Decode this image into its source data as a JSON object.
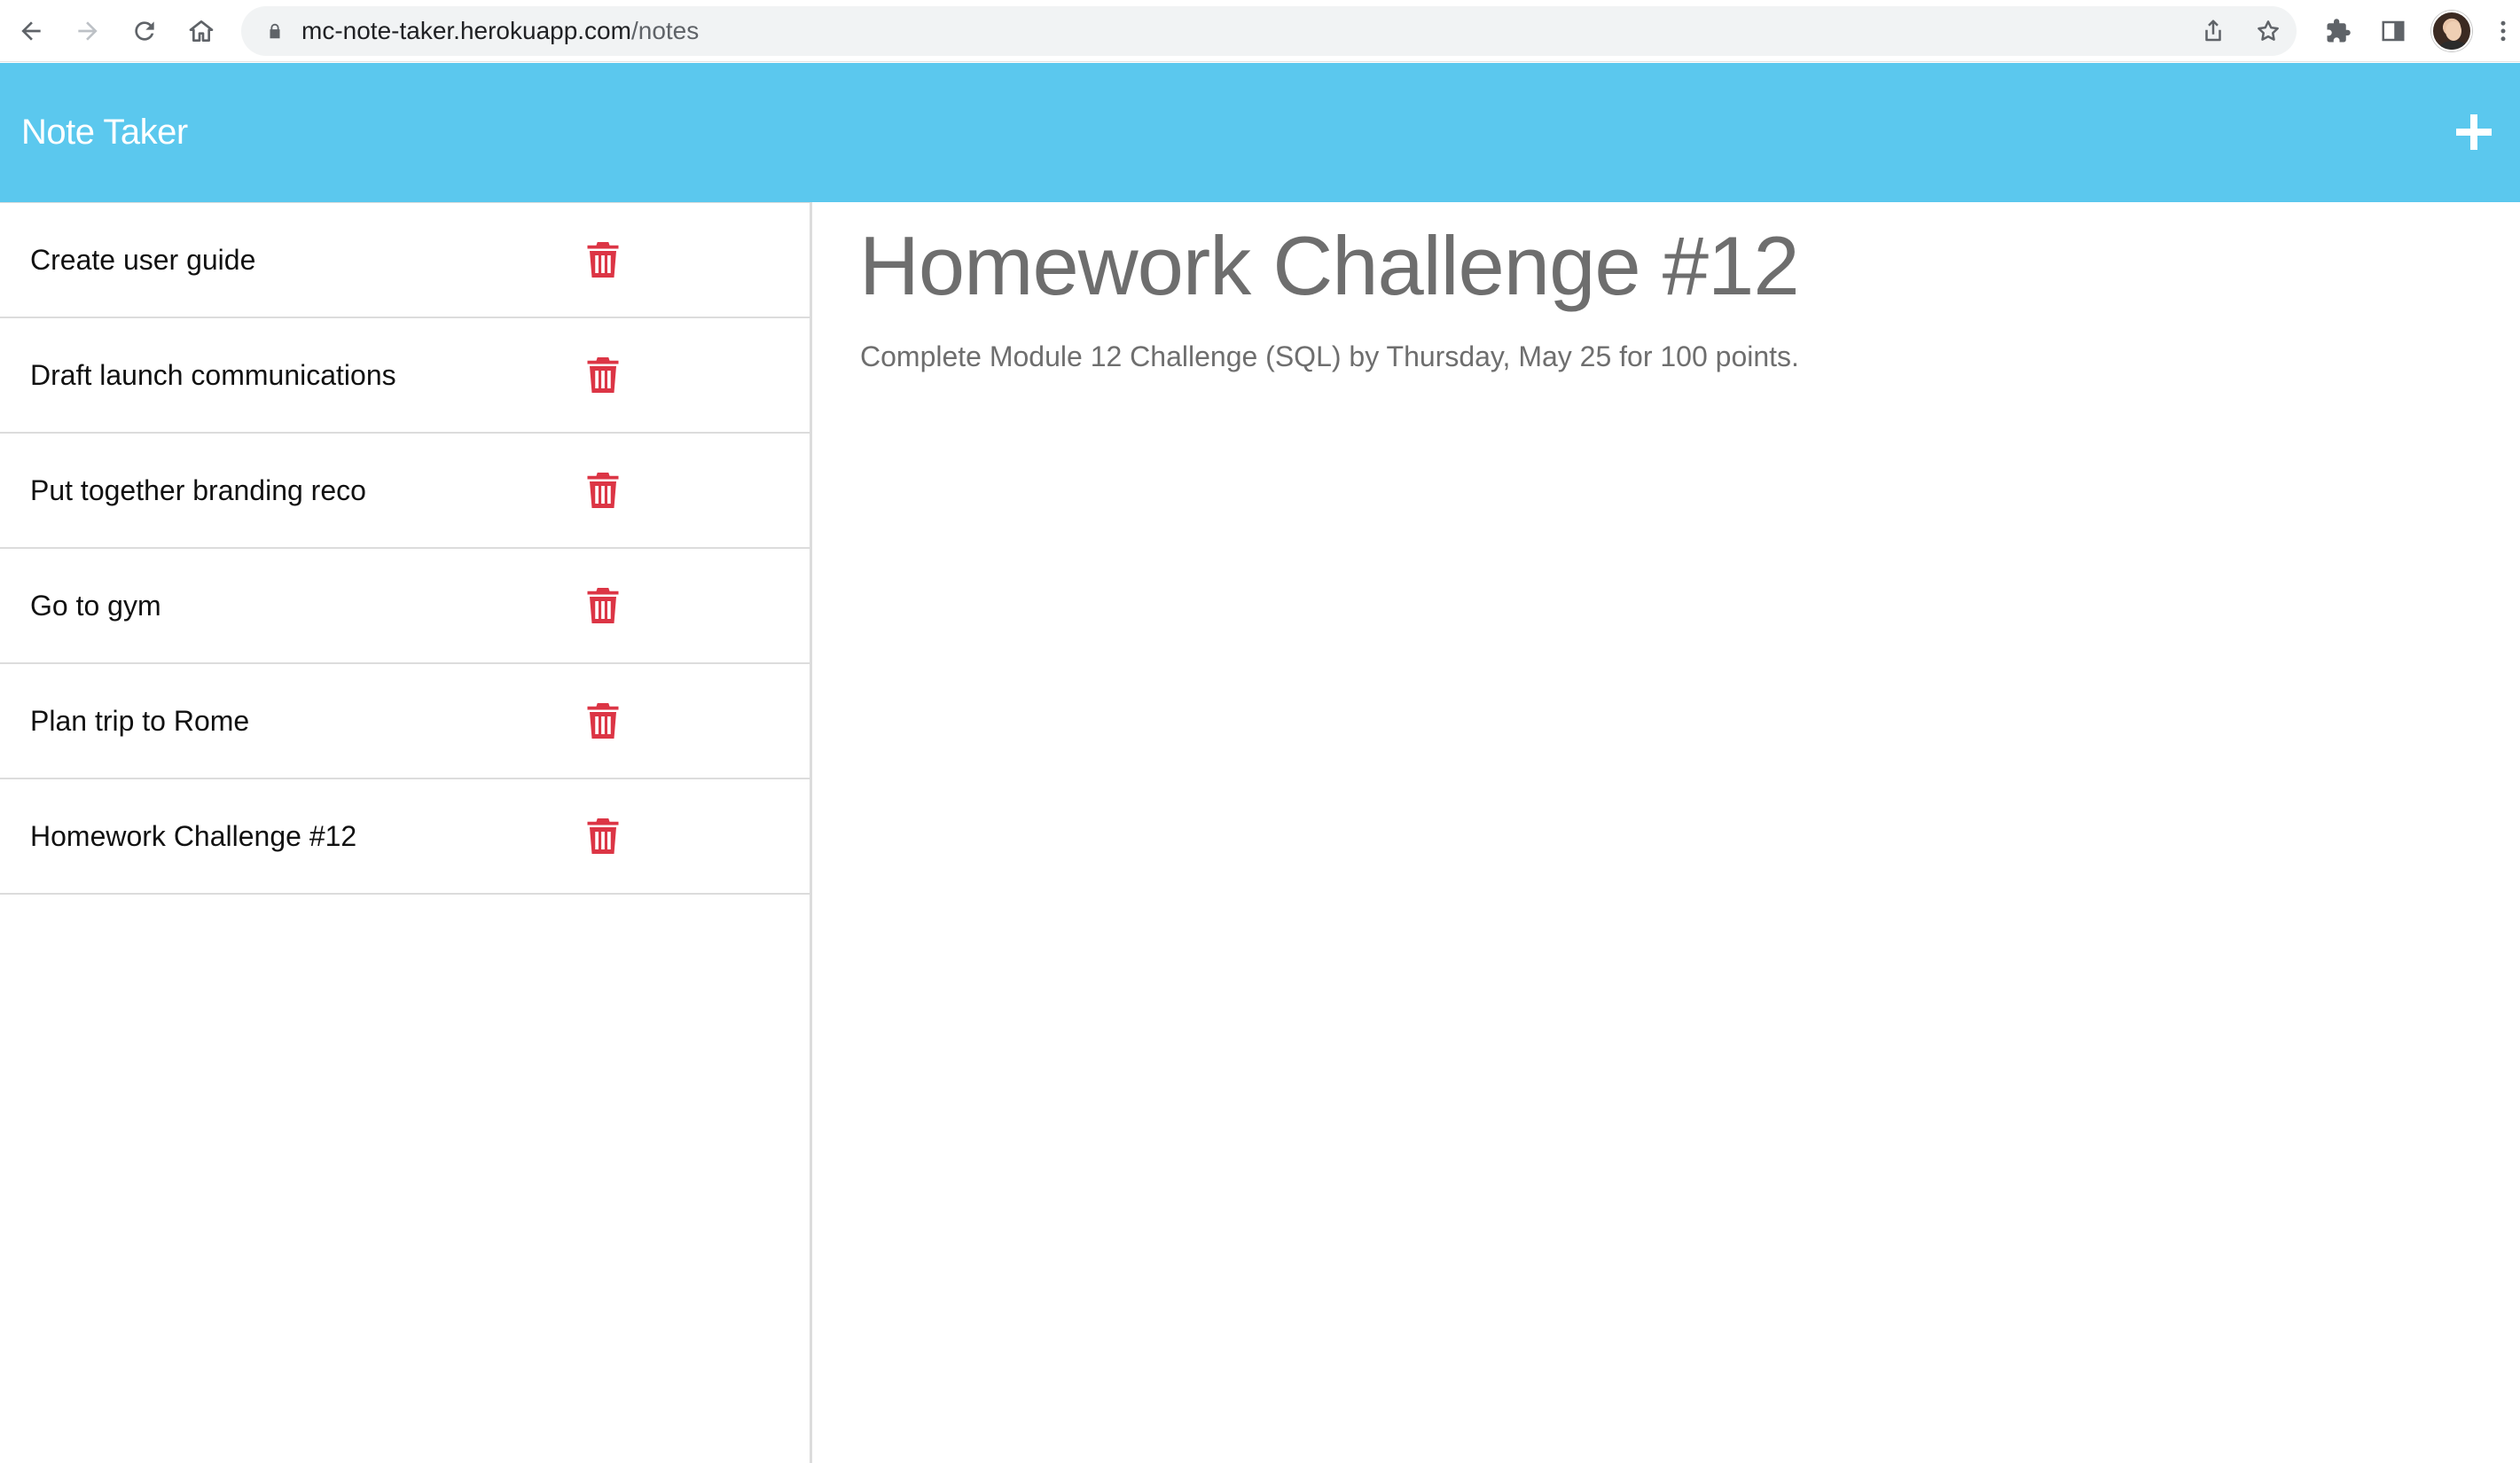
{
  "browser": {
    "url_host": "mc-note-taker.herokuapp.com",
    "url_path": "/notes",
    "icons": {
      "back": "back-arrow-icon",
      "forward": "forward-arrow-icon",
      "reload": "reload-icon",
      "home": "home-icon",
      "lock": "lock-icon",
      "share": "share-icon",
      "bookmark": "star-icon",
      "extensions": "puzzle-piece-icon",
      "side_panel": "side-panel-icon",
      "menu": "kebab-menu-icon"
    }
  },
  "app": {
    "title": "Note Taker",
    "header_color": "#5bc8ee",
    "new_note_icon": "plus-icon"
  },
  "notes": [
    {
      "title": "Create user guide",
      "delete_icon": "trash-icon"
    },
    {
      "title": "Draft launch communications",
      "delete_icon": "trash-icon"
    },
    {
      "title": "Put together branding reco",
      "delete_icon": "trash-icon"
    },
    {
      "title": "Go to gym",
      "delete_icon": "trash-icon"
    },
    {
      "title": "Plan trip to Rome",
      "delete_icon": "trash-icon"
    },
    {
      "title": "Homework Challenge #12",
      "delete_icon": "trash-icon"
    }
  ],
  "active_note": {
    "title": "Homework Challenge #12",
    "text": "Complete Module 12 Challenge (SQL) by Thursday, May 25 for 100 points."
  },
  "colors": {
    "delete": "#dc3545",
    "note_text": "#6e6e6e"
  }
}
